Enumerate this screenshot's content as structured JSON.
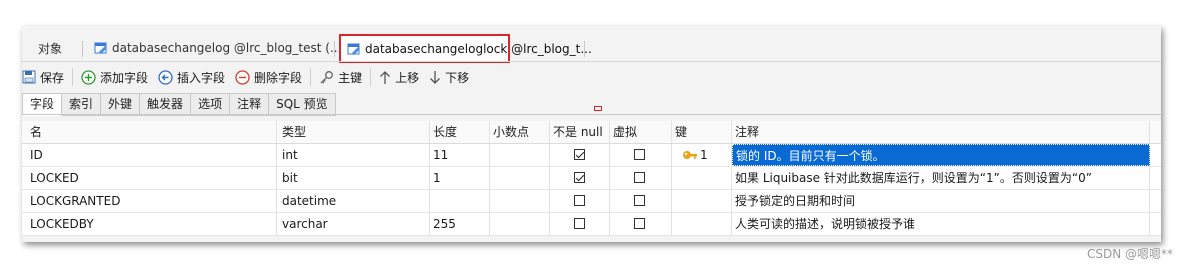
{
  "tabs": [
    {
      "label": "对象"
    },
    {
      "label": "databasechangelog @lrc_blog_test (..."
    },
    {
      "label": "databasechangeloglock @lrc_blog_t..."
    }
  ],
  "toolbar": {
    "save": "保存",
    "add_field": "添加字段",
    "insert_field": "插入字段",
    "delete_field": "删除字段",
    "primary_key": "主键",
    "move_up": "上移",
    "move_down": "下移"
  },
  "subtabs": [
    "字段",
    "索引",
    "外键",
    "触发器",
    "选项",
    "注释",
    "SQL 预览"
  ],
  "columns": {
    "name": "名",
    "type": "类型",
    "length": "长度",
    "decimal": "小数点",
    "not_null": "不是 null",
    "virtual": "虚拟",
    "key": "键",
    "comment": "注释"
  },
  "rows": [
    {
      "name": "ID",
      "type": "int",
      "length": "11",
      "decimal": "",
      "not_null": true,
      "virtual": false,
      "key": "1",
      "comment": "锁的 ID。目前只有一个锁。"
    },
    {
      "name": "LOCKED",
      "type": "bit",
      "length": "1",
      "decimal": "",
      "not_null": true,
      "virtual": false,
      "key": "",
      "comment": "如果 Liquibase 针对此数据库运行，则设置为“1”。否则设置为“0”"
    },
    {
      "name": "LOCKGRANTED",
      "type": "datetime",
      "length": "",
      "decimal": "",
      "not_null": false,
      "virtual": false,
      "key": "",
      "comment": "授予锁定的日期和时间"
    },
    {
      "name": "LOCKEDBY",
      "type": "varchar",
      "length": "255",
      "decimal": "",
      "not_null": false,
      "virtual": false,
      "key": "",
      "comment": "人类可读的描述，说明锁被授予谁"
    }
  ],
  "watermark": "CSDN @嗯嗯**",
  "colors": {
    "selection": "#0a6ad4",
    "highlight_border": "#d9262b",
    "key_icon": "#e8a317"
  }
}
